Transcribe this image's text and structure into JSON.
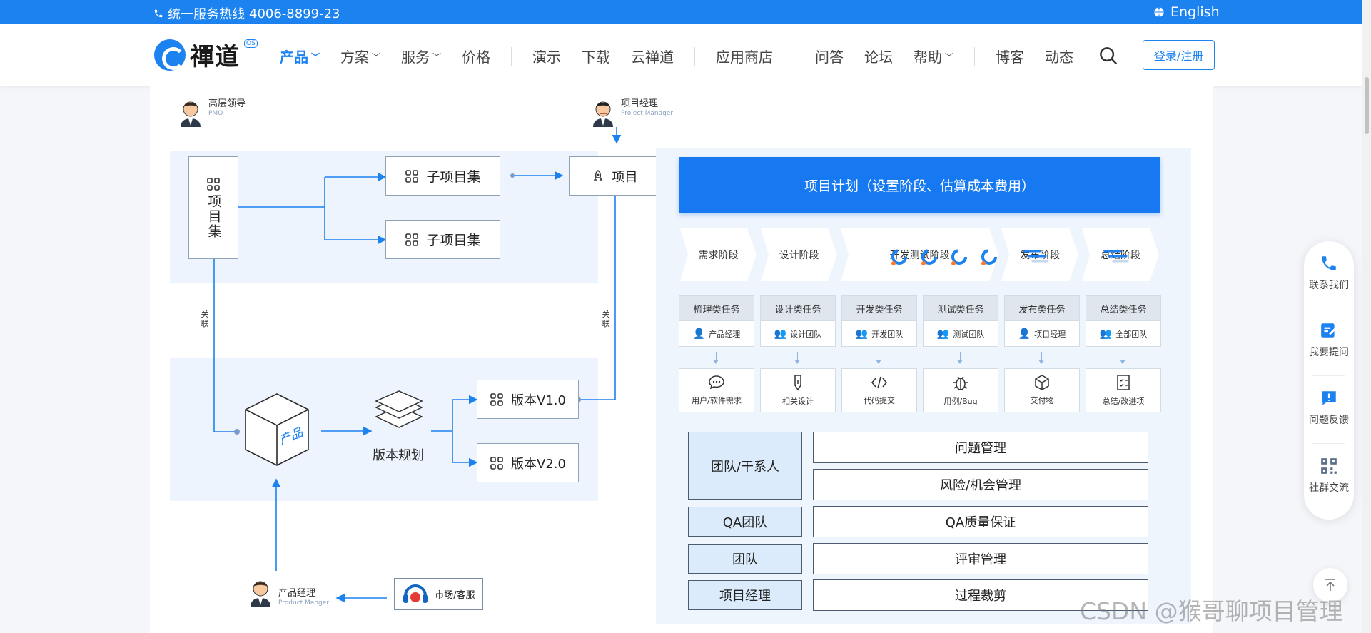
{
  "topbar": {
    "hotline_label": "统一服务热线",
    "hotline_number": "4006-8899-23",
    "language": "English"
  },
  "logo": {
    "name": "禪道",
    "badge": "OS"
  },
  "nav": {
    "items": [
      "产品",
      "方案",
      "服务",
      "价格",
      "演示",
      "下载",
      "云禅道",
      "应用商店",
      "问答",
      "论坛",
      "帮助",
      "博客",
      "动态"
    ],
    "login": "登录/注册"
  },
  "left": {
    "roles": {
      "leader": "高层领导",
      "leader_en": "PMO",
      "pm": "项目经理",
      "pm_en": "Project Manager",
      "product": "产品经理",
      "product_en": "Product Manger"
    },
    "program": "项目集",
    "subprogram1": "子项目集",
    "subprogram2": "子项目集",
    "project": "项目",
    "relate1": "关联",
    "relate2": "关联",
    "product_box": "产品",
    "release_plan": "版本规划",
    "v1": "版本V1.0",
    "v2": "版本V2.0",
    "market": "市场/客服"
  },
  "right": {
    "plan": "项目计划（设置阶段、估算成本费用）",
    "stages": [
      "需求阶段",
      "设计阶段",
      "开发测试阶段",
      "发布阶段",
      "总结阶段"
    ],
    "tasks": [
      {
        "head": "梳理类任务",
        "role": "产品经理",
        "out": "用户/软件需求",
        "icon": "chat-icon"
      },
      {
        "head": "设计类任务",
        "role": "设计团队",
        "out": "相关设计",
        "icon": "pen-icon"
      },
      {
        "head": "开发类任务",
        "role": "开发团队",
        "out": "代码提交",
        "icon": "code-icon"
      },
      {
        "head": "测试类任务",
        "role": "测试团队",
        "out": "用例/Bug",
        "icon": "bug-icon"
      },
      {
        "head": "发布类任务",
        "role": "项目经理",
        "out": "交付物",
        "icon": "cube-icon"
      },
      {
        "head": "总结类任务",
        "role": "全部团队",
        "out": "总结/改进项",
        "icon": "checklist-icon"
      }
    ],
    "matrix_left": [
      "团队/干系人",
      "QA团队",
      "团队",
      "项目经理"
    ],
    "matrix_right": [
      "问题管理",
      "风险/机会管理",
      "QA质量保证",
      "评审管理",
      "过程裁剪"
    ]
  },
  "sidebar": {
    "items": [
      "联系我们",
      "我要提问",
      "问题反馈",
      "社群交流"
    ]
  },
  "watermark": "CSDN @猴哥聊项目管理",
  "colors": {
    "brand": "#1c82f0",
    "plan": "#1679f2",
    "panel": "#edf4fd"
  }
}
